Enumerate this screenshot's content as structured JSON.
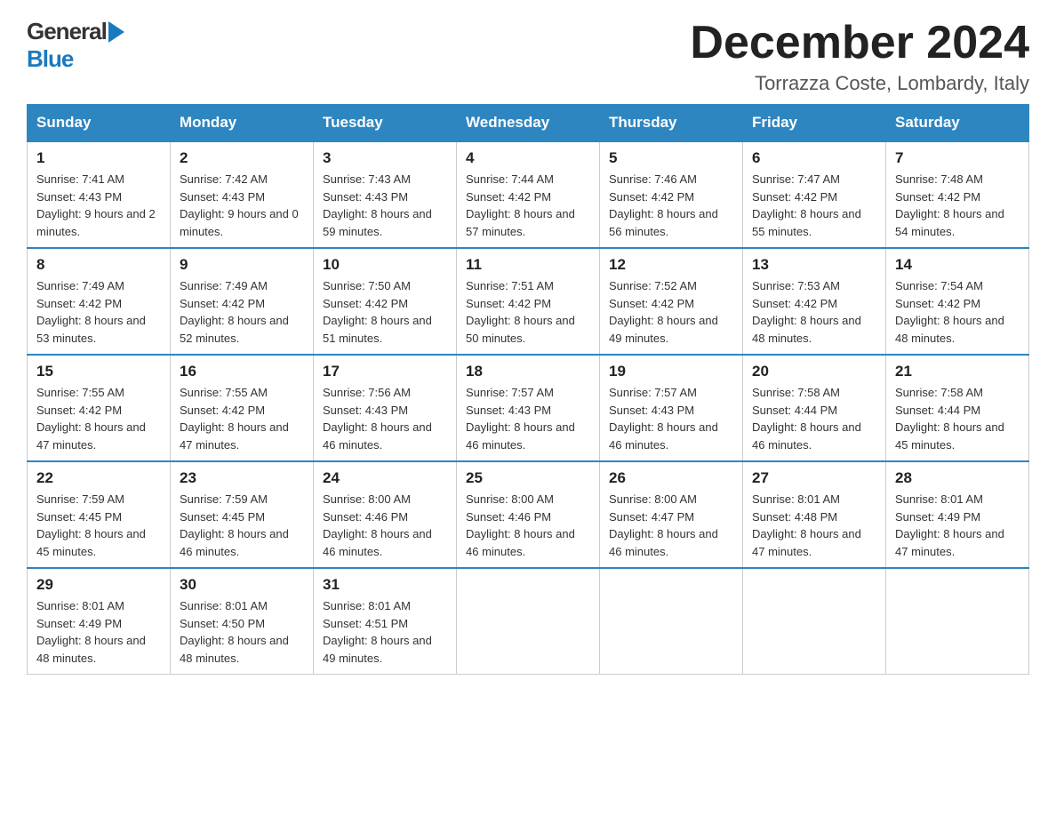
{
  "header": {
    "logo_top": "General",
    "logo_bottom": "Blue",
    "month_title": "December 2024",
    "location": "Torrazza Coste, Lombardy, Italy"
  },
  "days_of_week": [
    "Sunday",
    "Monday",
    "Tuesday",
    "Wednesday",
    "Thursday",
    "Friday",
    "Saturday"
  ],
  "weeks": [
    [
      {
        "date": "1",
        "sunrise": "7:41 AM",
        "sunset": "4:43 PM",
        "daylight": "9 hours and 2 minutes."
      },
      {
        "date": "2",
        "sunrise": "7:42 AM",
        "sunset": "4:43 PM",
        "daylight": "9 hours and 0 minutes."
      },
      {
        "date": "3",
        "sunrise": "7:43 AM",
        "sunset": "4:43 PM",
        "daylight": "8 hours and 59 minutes."
      },
      {
        "date": "4",
        "sunrise": "7:44 AM",
        "sunset": "4:42 PM",
        "daylight": "8 hours and 57 minutes."
      },
      {
        "date": "5",
        "sunrise": "7:46 AM",
        "sunset": "4:42 PM",
        "daylight": "8 hours and 56 minutes."
      },
      {
        "date": "6",
        "sunrise": "7:47 AM",
        "sunset": "4:42 PM",
        "daylight": "8 hours and 55 minutes."
      },
      {
        "date": "7",
        "sunrise": "7:48 AM",
        "sunset": "4:42 PM",
        "daylight": "8 hours and 54 minutes."
      }
    ],
    [
      {
        "date": "8",
        "sunrise": "7:49 AM",
        "sunset": "4:42 PM",
        "daylight": "8 hours and 53 minutes."
      },
      {
        "date": "9",
        "sunrise": "7:49 AM",
        "sunset": "4:42 PM",
        "daylight": "8 hours and 52 minutes."
      },
      {
        "date": "10",
        "sunrise": "7:50 AM",
        "sunset": "4:42 PM",
        "daylight": "8 hours and 51 minutes."
      },
      {
        "date": "11",
        "sunrise": "7:51 AM",
        "sunset": "4:42 PM",
        "daylight": "8 hours and 50 minutes."
      },
      {
        "date": "12",
        "sunrise": "7:52 AM",
        "sunset": "4:42 PM",
        "daylight": "8 hours and 49 minutes."
      },
      {
        "date": "13",
        "sunrise": "7:53 AM",
        "sunset": "4:42 PM",
        "daylight": "8 hours and 48 minutes."
      },
      {
        "date": "14",
        "sunrise": "7:54 AM",
        "sunset": "4:42 PM",
        "daylight": "8 hours and 48 minutes."
      }
    ],
    [
      {
        "date": "15",
        "sunrise": "7:55 AM",
        "sunset": "4:42 PM",
        "daylight": "8 hours and 47 minutes."
      },
      {
        "date": "16",
        "sunrise": "7:55 AM",
        "sunset": "4:42 PM",
        "daylight": "8 hours and 47 minutes."
      },
      {
        "date": "17",
        "sunrise": "7:56 AM",
        "sunset": "4:43 PM",
        "daylight": "8 hours and 46 minutes."
      },
      {
        "date": "18",
        "sunrise": "7:57 AM",
        "sunset": "4:43 PM",
        "daylight": "8 hours and 46 minutes."
      },
      {
        "date": "19",
        "sunrise": "7:57 AM",
        "sunset": "4:43 PM",
        "daylight": "8 hours and 46 minutes."
      },
      {
        "date": "20",
        "sunrise": "7:58 AM",
        "sunset": "4:44 PM",
        "daylight": "8 hours and 46 minutes."
      },
      {
        "date": "21",
        "sunrise": "7:58 AM",
        "sunset": "4:44 PM",
        "daylight": "8 hours and 45 minutes."
      }
    ],
    [
      {
        "date": "22",
        "sunrise": "7:59 AM",
        "sunset": "4:45 PM",
        "daylight": "8 hours and 45 minutes."
      },
      {
        "date": "23",
        "sunrise": "7:59 AM",
        "sunset": "4:45 PM",
        "daylight": "8 hours and 46 minutes."
      },
      {
        "date": "24",
        "sunrise": "8:00 AM",
        "sunset": "4:46 PM",
        "daylight": "8 hours and 46 minutes."
      },
      {
        "date": "25",
        "sunrise": "8:00 AM",
        "sunset": "4:46 PM",
        "daylight": "8 hours and 46 minutes."
      },
      {
        "date": "26",
        "sunrise": "8:00 AM",
        "sunset": "4:47 PM",
        "daylight": "8 hours and 46 minutes."
      },
      {
        "date": "27",
        "sunrise": "8:01 AM",
        "sunset": "4:48 PM",
        "daylight": "8 hours and 47 minutes."
      },
      {
        "date": "28",
        "sunrise": "8:01 AM",
        "sunset": "4:49 PM",
        "daylight": "8 hours and 47 minutes."
      }
    ],
    [
      {
        "date": "29",
        "sunrise": "8:01 AM",
        "sunset": "4:49 PM",
        "daylight": "8 hours and 48 minutes."
      },
      {
        "date": "30",
        "sunrise": "8:01 AM",
        "sunset": "4:50 PM",
        "daylight": "8 hours and 48 minutes."
      },
      {
        "date": "31",
        "sunrise": "8:01 AM",
        "sunset": "4:51 PM",
        "daylight": "8 hours and 49 minutes."
      },
      null,
      null,
      null,
      null
    ]
  ]
}
